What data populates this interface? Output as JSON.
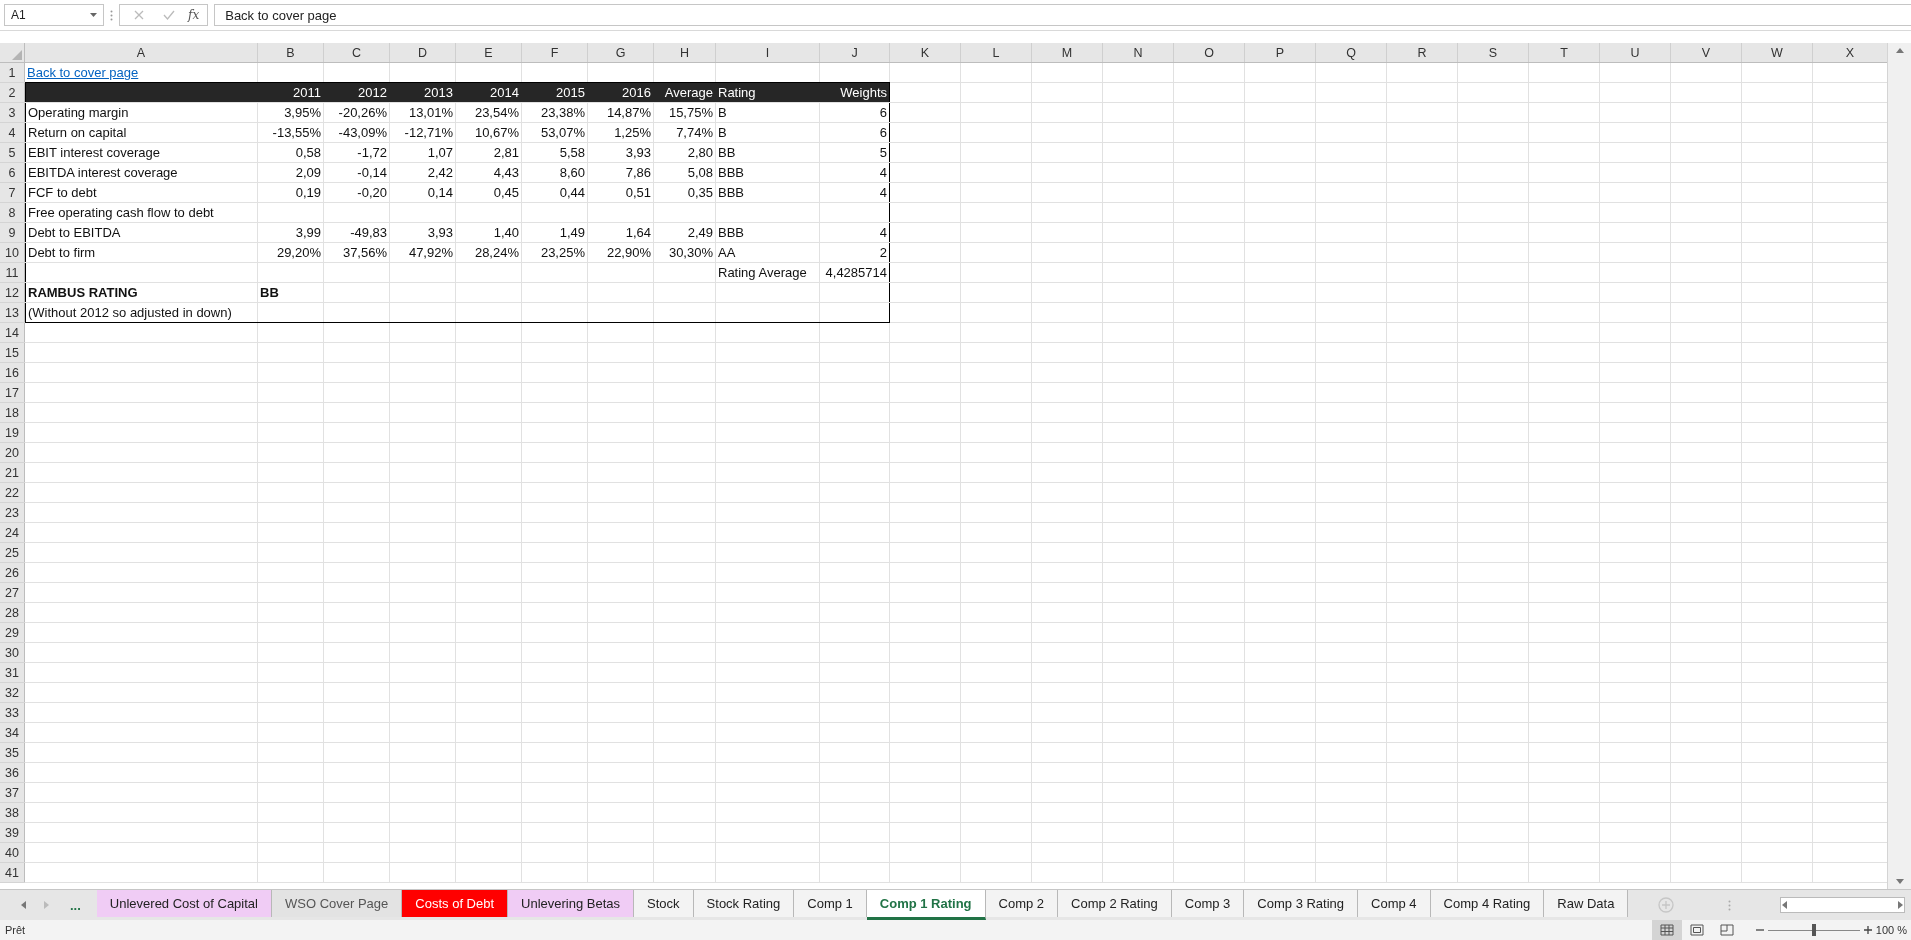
{
  "formula_bar": {
    "cell_reference": "A1",
    "function_label": "fx",
    "value": "Back to cover page"
  },
  "sheet": {
    "columns": [
      "A",
      "B",
      "C",
      "D",
      "E",
      "F",
      "G",
      "H",
      "I",
      "J",
      "K",
      "L",
      "M",
      "N",
      "O",
      "P",
      "Q",
      "R",
      "S",
      "T",
      "U",
      "V",
      "W",
      "X"
    ],
    "row_numbers": [
      "1",
      "2",
      "3",
      "4",
      "5",
      "6",
      "7",
      "8",
      "9",
      "10",
      "11",
      "12",
      "13",
      "14",
      "15",
      "16",
      "17",
      "18",
      "19",
      "20",
      "21",
      "22",
      "23",
      "24",
      "25",
      "26",
      "27",
      "28",
      "29",
      "30",
      "31",
      "32",
      "33",
      "34",
      "35",
      "36",
      "37",
      "38",
      "39",
      "40",
      "41"
    ],
    "rows": [
      {
        "kind": "link",
        "cells": {
          "A": "Back to cover page"
        }
      },
      {
        "kind": "header",
        "cells": {
          "B": "2011",
          "C": "2012",
          "D": "2013",
          "E": "2014",
          "F": "2015",
          "G": "2016",
          "H": "Average",
          "I": "Rating",
          "J": "Weights"
        }
      },
      {
        "kind": "data",
        "cells": {
          "A": "Operating margin",
          "B": "3,95%",
          "C": "-20,26%",
          "D": "13,01%",
          "E": "23,54%",
          "F": "23,38%",
          "G": "14,87%",
          "H": "15,75%",
          "I": "B",
          "J": "6"
        }
      },
      {
        "kind": "data",
        "cells": {
          "A": "Return on capital",
          "B": "-13,55%",
          "C": "-43,09%",
          "D": "-12,71%",
          "E": "10,67%",
          "F": "53,07%",
          "G": "1,25%",
          "H": "7,74%",
          "I": "B",
          "J": "6"
        }
      },
      {
        "kind": "data",
        "cells": {
          "A": "EBIT interest coverage",
          "B": "0,58",
          "C": "-1,72",
          "D": "1,07",
          "E": "2,81",
          "F": "5,58",
          "G": "3,93",
          "H": "2,80",
          "I": "BB",
          "J": "5"
        }
      },
      {
        "kind": "data",
        "cells": {
          "A": "EBITDA interest coverage",
          "B": "2,09",
          "C": "-0,14",
          "D": "2,42",
          "E": "4,43",
          "F": "8,60",
          "G": "7,86",
          "H": "5,08",
          "I": "BBB",
          "J": "4"
        }
      },
      {
        "kind": "data",
        "cells": {
          "A": "FCF to debt",
          "B": "0,19",
          "C": "-0,20",
          "D": "0,14",
          "E": "0,45",
          "F": "0,44",
          "G": "0,51",
          "H": "0,35",
          "I": "BBB",
          "J": "4"
        }
      },
      {
        "kind": "data",
        "cells": {
          "A": "Free operating cash flow to debt"
        }
      },
      {
        "kind": "data",
        "cells": {
          "A": "Debt to EBITDA",
          "B": "3,99",
          "C": "-49,83",
          "D": "3,93",
          "E": "1,40",
          "F": "1,49",
          "G": "1,64",
          "H": "2,49",
          "I": "BBB",
          "J": "4"
        }
      },
      {
        "kind": "data",
        "cells": {
          "A": "Debt to firm",
          "B": "29,20%",
          "C": "37,56%",
          "D": "47,92%",
          "E": "28,24%",
          "F": "23,25%",
          "G": "22,90%",
          "H": "30,30%",
          "I": "AA",
          "J": "2"
        }
      },
      {
        "kind": "data",
        "cells": {
          "I": "Rating Average",
          "J": "4,4285714"
        }
      },
      {
        "kind": "bold",
        "cells": {
          "A": "RAMBUS RATING",
          "B": "BB"
        }
      },
      {
        "kind": "data",
        "cells": {
          "A": "(Without 2012 so adjusted in down)"
        }
      }
    ]
  },
  "tab_overflow": "...",
  "tabs": [
    {
      "label": "Unlevered Cost of Capital",
      "selected": false,
      "color": "#f0ccf5"
    },
    {
      "label": "WSO Cover Page",
      "selected": false,
      "color": "#e3e3e3"
    },
    {
      "label": "Costs of Debt",
      "selected": false,
      "color": "#ff0000"
    },
    {
      "label": "Unlevering Betas",
      "selected": false,
      "color": "#f0ccf5"
    },
    {
      "label": "Stock",
      "selected": false
    },
    {
      "label": "Stock Rating",
      "selected": false
    },
    {
      "label": "Comp 1",
      "selected": false
    },
    {
      "label": "Comp 1 Rating",
      "selected": true
    },
    {
      "label": "Comp 2",
      "selected": false
    },
    {
      "label": "Comp 2 Rating",
      "selected": false
    },
    {
      "label": "Comp 3",
      "selected": false
    },
    {
      "label": "Comp 3 Rating",
      "selected": false
    },
    {
      "label": "Comp 4",
      "selected": false
    },
    {
      "label": "Comp 4 Rating",
      "selected": false
    },
    {
      "label": "Raw Data",
      "selected": false
    }
  ],
  "status_bar": {
    "text": "Prêt",
    "views": [
      {
        "kind": "normal",
        "selected": true
      },
      {
        "kind": "page_layout",
        "selected": false
      },
      {
        "kind": "page_break",
        "selected": false
      }
    ],
    "zoom": {
      "level": 0.5,
      "reading": "100 %"
    }
  }
}
